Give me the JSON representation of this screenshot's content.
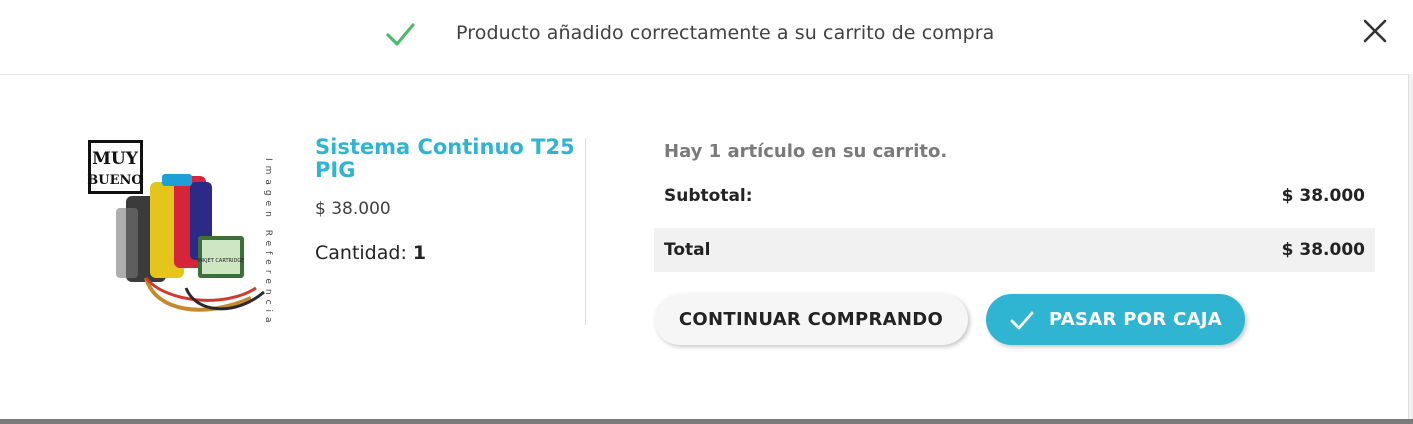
{
  "header": {
    "title": "Producto añadido correctamente a su carrito de compra",
    "success_icon": "check-icon",
    "close_icon": "close-icon",
    "success_color": "#4cbb6c"
  },
  "product": {
    "name": "Sistema Continuo T25 PIG",
    "price": "$ 38.000",
    "quantity_label": "Cantidad:",
    "quantity": "1",
    "image_badge_line1": "MUY",
    "image_badge_line2": "BUENO",
    "image_watermark": "Imagen Referencial",
    "image_cartridge_text": "INKJET CARTRIDGE"
  },
  "summary": {
    "cart_count_text": "Hay 1 artículo en su carrito.",
    "subtotal_label": "Subtotal:",
    "subtotal_value": "$ 38.000",
    "total_label": "Total",
    "total_value": "$ 38.000"
  },
  "actions": {
    "continue_label": "CONTINUAR COMPRANDO",
    "checkout_label": "PASAR POR CAJA",
    "accent_color": "#2fb5d2"
  }
}
